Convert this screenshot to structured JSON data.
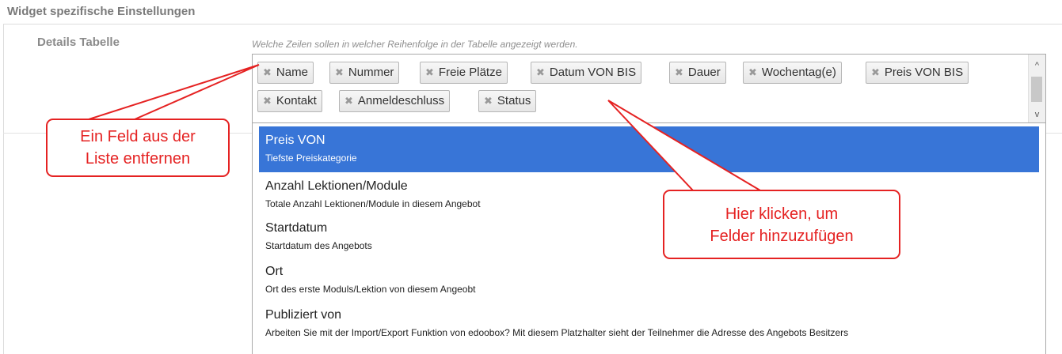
{
  "section": {
    "title": "Widget spezifische Einstellungen"
  },
  "field": {
    "label": "Details Tabelle",
    "hint": "Welche Zeilen sollen in welcher Reihenfolge in der Tabelle angezeigt werden."
  },
  "selected_tags": [
    "Name",
    "Nummer",
    "Freie Plätze",
    "Datum VON BIS",
    "Dauer",
    "Wochentag(e)",
    "Preis VON BIS",
    "Kontakt",
    "Anmeldeschluss",
    "Status"
  ],
  "remove_glyph": "✖",
  "scroll": {
    "up": "^",
    "down": "v"
  },
  "options": [
    {
      "title": "Preis VON",
      "desc": "Tiefste Preiskategorie"
    },
    {
      "title": "Anzahl Lektionen/Module",
      "desc": "Totale Anzahl Lektionen/Module in diesem Angebot"
    },
    {
      "title": "Startdatum",
      "desc": "Startdatum des Angebots"
    },
    {
      "title": "Ort",
      "desc": "Ort des erste Moduls/Lektion von diesem Angeobt"
    },
    {
      "title": "Publiziert von",
      "desc": "Arbeiten Sie mit der Import/Export Funktion von edoobox? Mit diesem Platzhalter sieht der Teilnehmer die Adresse des Angebots Besitzers"
    }
  ],
  "callouts": {
    "remove": {
      "line1": "Ein Feld aus der",
      "line2": "Liste entfernen"
    },
    "add": {
      "line1": "Hier klicken, um",
      "line2": "Felder hinzuzufügen"
    }
  },
  "colors": {
    "highlight": "#3875d7",
    "annotation": "#e52222"
  }
}
